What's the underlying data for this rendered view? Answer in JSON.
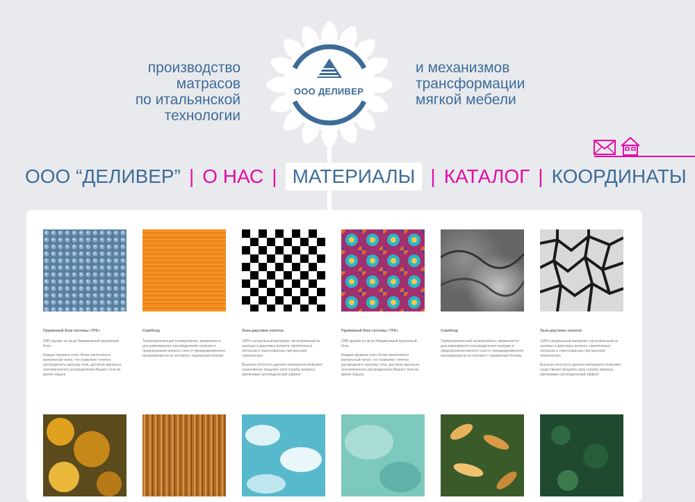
{
  "tagline_left": [
    "производство",
    "матрасов",
    "по итальянской",
    "технологии"
  ],
  "tagline_right": [
    "и механизмов",
    "трансформации",
    "мягкой мебели"
  ],
  "logo": {
    "text": "ООО ДЕЛИВЕР"
  },
  "icons": {
    "mail": "envelope-icon",
    "home": "house-icon",
    "accent": "#e30ba6"
  },
  "nav": {
    "brand": "ООО “ДЕЛИВЕР”",
    "separator": "|",
    "items": [
      {
        "label": "О НАС",
        "color": "pink"
      },
      {
        "label": "МАТЕРИАЛЫ",
        "color": "active"
      },
      {
        "label": "КАТАЛОГ",
        "color": "pink"
      },
      {
        "label": "КООРДИНАТЫ",
        "color": "blue"
      }
    ]
  },
  "materials": [
    {
      "title": "Пружинный блок системы «TFK»",
      "paragraphs": [
        "(280 пружин на кв.м) Независимый пружинный блок.",
        "Каждая пружина этого блока заключена в матерчатый чехол, что позволяет точечно распределить нагрузку тела, достигая идеально анатомического распределения Вашего тела во время отдыха"
      ]
    },
    {
      "title": "Спанбонд",
      "paragraphs": [
        "Термоскрепленный полипропилен, применяется для равномерного распределения нагрузки и предохранения мягкого слоя от преждевременного изнашивания из-за контакта с пружинным блоком."
      ]
    },
    {
      "title": "Льно-джутовое полотно",
      "paragraphs": [
        "100% натуральный материал, изготовленный из льняных и джутовых волокон, пропитанных латексом и спрессованных при высокой температуре.",
        "Высокая плотность данного материала позволяет существенно продлить срок службы матраса, увеличивая ортопедический эффект"
      ]
    },
    {
      "title": "Пружинный блок системы «TFK»",
      "paragraphs": [
        "(280 пружин на кв.м) Независимый пружинный блок.",
        "Каждая пружина этого блока заключена в матерчатый чехол, что позволяет точечно распределить нагрузку тела, достигая идеально анатомического распределения Вашего тела во время отдыха"
      ]
    },
    {
      "title": "Спанбонд",
      "paragraphs": [
        "Термоскрепленный полипропилен, применяется для равномерного распределения нагрузки и предохранения мягкого слоя от преждевременного изнашивания из-за контакта с пружинным блоком."
      ]
    },
    {
      "title": "Льно-джутовое полотно",
      "paragraphs": [
        "100% натуральный материал, изготовленный из льняных и джутовых волокон, пропитанных латексом и спрессованных при высокой температуре.",
        "Высокая плотность данного материала позволяет существенно продлить срок службы матраса, увеличивая ортопедический эффект"
      ]
    }
  ]
}
